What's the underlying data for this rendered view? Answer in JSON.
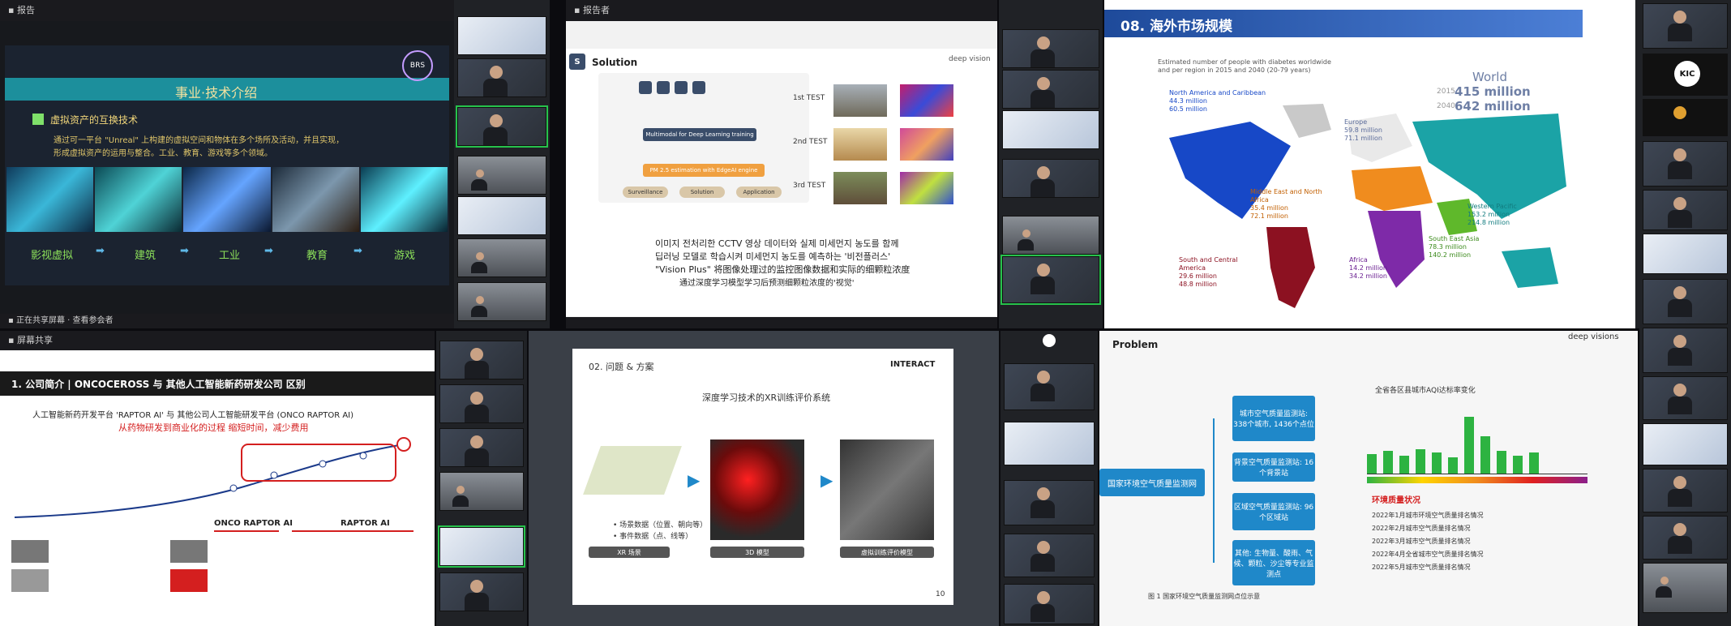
{
  "q1": {
    "header": "事业·技术介绍",
    "bullet_title": "虚拟资产的互换技术",
    "body_line1": "通过可一平台 \"Unreal\" 上构建的虚拟空间和物体在多个场所及活动，并且实现，",
    "body_line2": "形成虚拟资产的运用与整合。工业、教育、游戏等多个领域。",
    "steps": [
      "影视虚拟",
      "建筑",
      "工业",
      "教育",
      "游戏"
    ],
    "badge": "BRS"
  },
  "q2": {
    "logo_letter": "S",
    "title": "Solution",
    "brand": "deep vision",
    "tests": [
      "1st TEST",
      "2nd TEST",
      "3rd TEST"
    ],
    "line1": "이미지 전처리한 CCTV 영상 데이터와 실제 미세먼지 농도를 함께",
    "line2": "딥러닝 모델로 학습시켜 미세먼지 농도를 예측하는 '비전플러스'",
    "line3": "\"Vision Plus\" 将图像处理过的监控图像数据和实际的细颗粒浓度",
    "line4": "通过深度学习模型学习后预测细颗粒浓度的'视觉'",
    "flow_top": "Multimodal for Deep Learning training",
    "flow_mid": "PM 2.5 estimation with EdgeAI engine",
    "flow_out": [
      "Surveillance",
      "Solution",
      "Application"
    ]
  },
  "q3": {
    "title": "08. 海外市场规模",
    "subtitle1": "Estimated number of people with diabetes worldwide",
    "subtitle2": "and per region in 2015 and 2040 (20-79 years)",
    "world_label": "World",
    "world_2015_year": "2015",
    "world_2015": "415 million",
    "world_2040_year": "2040",
    "world_2040": "642 million",
    "regions": [
      {
        "name": "North America and Caribbean",
        "v2015": "44.3 million",
        "v2040": "60.5 million"
      },
      {
        "name": "Europe",
        "v2015": "59.8 million",
        "v2040": "71.1 million"
      },
      {
        "name": "Middle East and North Africa",
        "v2015": "35.4 million",
        "v2040": "72.1 million"
      },
      {
        "name": "Western Pacific",
        "v2015": "153.2 million",
        "v2040": "214.8 million"
      },
      {
        "name": "South East Asia",
        "v2015": "78.3 million",
        "v2040": "140.2 million"
      },
      {
        "name": "Africa",
        "v2015": "14.2 million",
        "v2040": "34.2 million"
      },
      {
        "name": "South and Central America",
        "v2015": "29.6 million",
        "v2040": "48.8 million"
      }
    ],
    "kic_text": "KIC"
  },
  "q4": {
    "header": "1. 公司简介 | ONCOCEROSS 与 其他人工智能新药研发公司 区别",
    "line1": "人工智能新药开发平台 'RAPTOR AI' 与 其他公司人工智能研发平台 (ONCO RAPTOR AI)",
    "line2": "从药物研发到商业化的过程 缩短时间，减少费用",
    "col1": "ONCO RAPTOR AI",
    "col2": "RAPTOR AI"
  },
  "q5": {
    "title": "02. 问题 & 方案",
    "logo": "INTERACT",
    "subtitle": "深度学习技术的XR训练评价系统",
    "cap1": "XR 场景",
    "cap2": "3D 模型",
    "cap3": "虚拟训练评价模型",
    "bullet1": "• 场景数据（位置、朝向等）",
    "bullet2": "• 事件数据（点、线等）",
    "page": "10"
  },
  "q6": {
    "title": "Problem",
    "brand": "deep visions",
    "main_box": "国家环境空气质量监测网",
    "boxes": [
      "城市空气质量监测站: 338个城市, 1436个点位",
      "背景空气质量监测站: 16个背景站",
      "区域空气质量监测站: 96个区域站",
      "其他: 生物量、酸雨、气候、颗粒、沙尘等专业监测点"
    ],
    "chart_title": "全省各区县城市AQI达标率变化",
    "sub_title": "环境质量状况",
    "list": [
      "2022年1月城市环境空气质量排名情况",
      "2022年2月城市空气质量排名情况",
      "2022年3月城市空气质量排名情况",
      "2022年4月全省城市空气质量排名情况",
      "2022年5月城市空气质量排名情况"
    ],
    "caption": "图 1  国家环境空气质量监测网点位示意"
  },
  "windows": {
    "q1_top": "▪ 报告",
    "q1_bottom": "▪ 正在共享屏幕 · 查看参会者",
    "q2_top": "▪ 报告者",
    "q4_top": "▪ 屏幕共享"
  },
  "colors": {
    "q1_bg": "#1b2330",
    "teal_bar": "#1c8f9c",
    "q2_orange": "#f0a040",
    "q4_red": "#d41f1f",
    "q5_bg": "#3a3f47",
    "q6_box": "#1f88c9"
  }
}
